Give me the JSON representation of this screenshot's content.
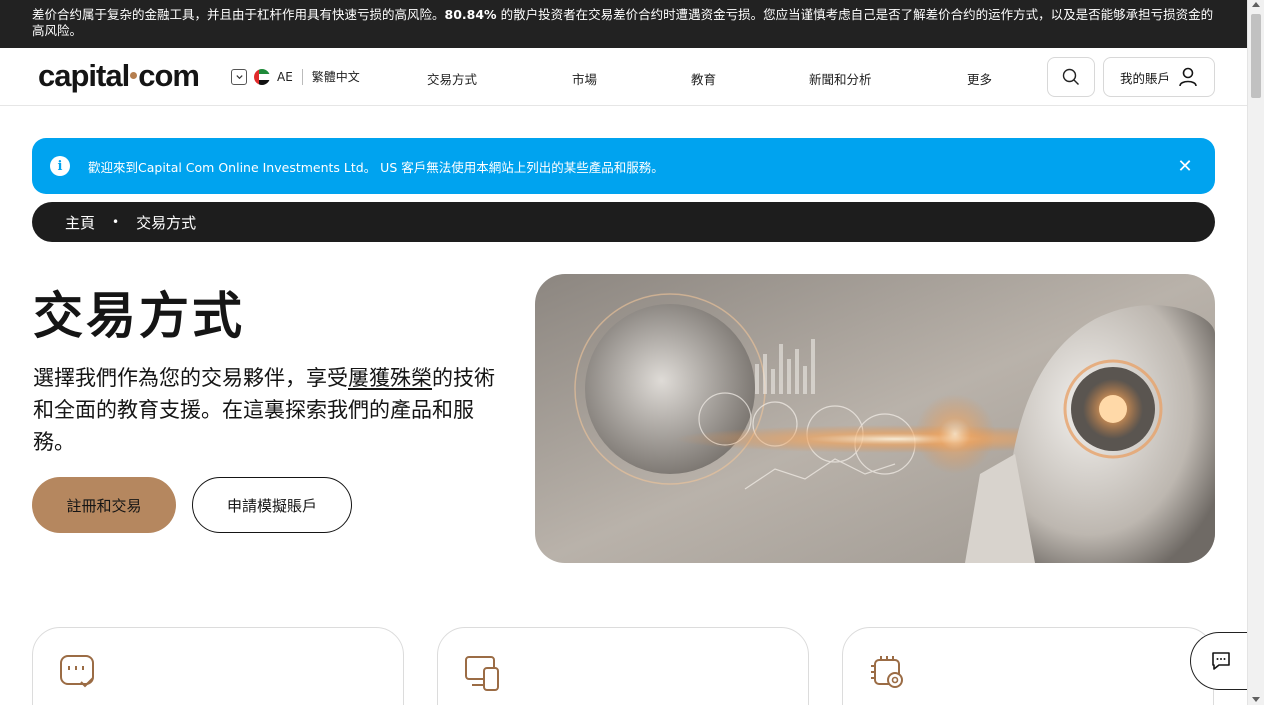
{
  "risk_banner": {
    "text_before": "差价合约属于复杂的金融工具，并且由于杠杆作用具有快速亏损的高风险。",
    "percent": "80.84%",
    "text_after": " 的散户投资者在交易差价合约时遭遇资金亏损。您应当谨慎考虑自己是否了解差价合约的运作方式，以及是否能够承担亏损资金的高风险。"
  },
  "header": {
    "logo_left": "capital",
    "logo_right": "com",
    "region_code": "AE",
    "language": "繁體中文",
    "nav": [
      "交易方式",
      "市場",
      "教育",
      "新聞和分析",
      "更多"
    ],
    "account_label": "我的賬戶"
  },
  "info_banner": {
    "text": "歡迎來到Capital Com Online Investments Ltd。 US 客戶無法使用本網站上列出的某些產品和服務。"
  },
  "breadcrumb": {
    "home": "主頁",
    "separator": "•",
    "current": "交易方式"
  },
  "hero": {
    "title": "交易方式",
    "desc_before": "選擇我們作為您的交易夥伴，享受",
    "desc_link": "屢獲殊榮",
    "desc_after": "的技術和全面的教育支援。在這裏探索我們的產品和服務。",
    "primary_button": "註冊和交易",
    "secondary_button": "申請模擬賬戶"
  },
  "cards": [
    {
      "icon": "chat-check-icon"
    },
    {
      "icon": "devices-icon"
    },
    {
      "icon": "chip-gear-icon"
    }
  ],
  "colors": {
    "accent": "#b5875f",
    "info": "#00a3ef",
    "dark": "#1d1d1d"
  }
}
